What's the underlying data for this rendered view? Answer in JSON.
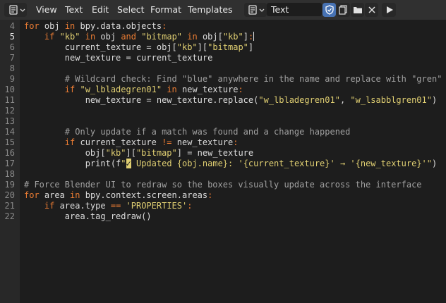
{
  "header": {
    "menu": [
      "View",
      "Text",
      "Edit",
      "Select",
      "Format",
      "Templates"
    ],
    "text_block_name": "Text",
    "icons": [
      "editor-type-icon",
      "dropdown-chevron-icon",
      "text-datablock-icon",
      "shield-fake-user-icon",
      "new-text-icon",
      "open-folder-icon",
      "close-x-icon",
      "run-script-play-icon"
    ]
  },
  "editor": {
    "current_line": 5,
    "lines": [
      {
        "n": "4",
        "tokens": [
          [
            "kw",
            "for"
          ],
          [
            "plain",
            " obj "
          ],
          [
            "kw",
            "in"
          ],
          [
            "plain",
            " bpy.data.objects"
          ],
          [
            "kw",
            ":"
          ]
        ]
      },
      {
        "n": "5",
        "tokens": [
          [
            "plain",
            "    "
          ],
          [
            "kw",
            "if"
          ],
          [
            "plain",
            " "
          ],
          [
            "str",
            "\"kb\""
          ],
          [
            "plain",
            " "
          ],
          [
            "kw",
            "in"
          ],
          [
            "plain",
            " obj "
          ],
          [
            "kw",
            "and"
          ],
          [
            "plain",
            " "
          ],
          [
            "str",
            "\"bitmap\""
          ],
          [
            "plain",
            " "
          ],
          [
            "kw",
            "in"
          ],
          [
            "plain",
            " obj["
          ],
          [
            "str",
            "\"kb\""
          ],
          [
            "plain",
            "]"
          ],
          [
            "kw",
            ":"
          ],
          [
            "cursor",
            ""
          ]
        ]
      },
      {
        "n": "6",
        "tokens": [
          [
            "plain",
            "        current_texture = obj["
          ],
          [
            "str",
            "\"kb\""
          ],
          [
            "plain",
            "]["
          ],
          [
            "str",
            "\"bitmap\""
          ],
          [
            "plain",
            "]"
          ]
        ]
      },
      {
        "n": "7",
        "tokens": [
          [
            "plain",
            "        new_texture = current_texture"
          ]
        ]
      },
      {
        "n": "8",
        "tokens": []
      },
      {
        "n": "9",
        "tokens": [
          [
            "cm",
            "        # Wildcard check: Find \"blue\" anywhere in the name and replace with \"gren\""
          ]
        ]
      },
      {
        "n": "10",
        "tokens": [
          [
            "plain",
            "        "
          ],
          [
            "kw",
            "if"
          ],
          [
            "plain",
            " "
          ],
          [
            "str",
            "\"w_lbladegren01\""
          ],
          [
            "plain",
            " "
          ],
          [
            "kw",
            "in"
          ],
          [
            "plain",
            " new_texture"
          ],
          [
            "kw",
            ":"
          ]
        ]
      },
      {
        "n": "11",
        "tokens": [
          [
            "plain",
            "            new_texture = new_texture.replace("
          ],
          [
            "str",
            "\"w_lbladegren01\""
          ],
          [
            "plain",
            ", "
          ],
          [
            "str",
            "\"w_lsabblgren01\""
          ],
          [
            "plain",
            ")"
          ]
        ]
      },
      {
        "n": "12",
        "tokens": []
      },
      {
        "n": "13",
        "tokens": []
      },
      {
        "n": "14",
        "tokens": [
          [
            "cm",
            "        # Only update if a match was found and a change happened"
          ]
        ]
      },
      {
        "n": "15",
        "tokens": [
          [
            "plain",
            "        "
          ],
          [
            "kw",
            "if"
          ],
          [
            "plain",
            " current_texture "
          ],
          [
            "kw",
            "!="
          ],
          [
            "plain",
            " new_texture"
          ],
          [
            "kw",
            ":"
          ]
        ]
      },
      {
        "n": "16",
        "tokens": [
          [
            "plain",
            "            obj["
          ],
          [
            "str",
            "\"kb\""
          ],
          [
            "plain",
            "]["
          ],
          [
            "str",
            "\"bitmap\""
          ],
          [
            "plain",
            "] = new_texture"
          ]
        ]
      },
      {
        "n": "17",
        "tokens": [
          [
            "plain",
            "            print(f"
          ],
          [
            "str",
            "\""
          ],
          [
            "hl",
            "✓"
          ],
          [
            "str",
            " Updated {obj.name}: '{current_texture}' → '{new_texture}'\""
          ],
          [
            "plain",
            ")"
          ]
        ]
      },
      {
        "n": "18",
        "tokens": []
      },
      {
        "n": "19",
        "tokens": [
          [
            "cm",
            "# Force Blender UI to redraw so the boxes visually update across the interface"
          ]
        ]
      },
      {
        "n": "20",
        "tokens": [
          [
            "kw",
            "for"
          ],
          [
            "plain",
            " area "
          ],
          [
            "kw",
            "in"
          ],
          [
            "plain",
            " bpy.context.screen.areas"
          ],
          [
            "kw",
            ":"
          ]
        ]
      },
      {
        "n": "21",
        "tokens": [
          [
            "plain",
            "    "
          ],
          [
            "kw",
            "if"
          ],
          [
            "plain",
            " area.type "
          ],
          [
            "kw",
            "=="
          ],
          [
            "plain",
            " "
          ],
          [
            "str",
            "'PROPERTIES'"
          ],
          [
            "kw",
            ":"
          ]
        ]
      },
      {
        "n": "22",
        "tokens": [
          [
            "plain",
            "        area.tag_redraw()"
          ]
        ]
      }
    ]
  }
}
